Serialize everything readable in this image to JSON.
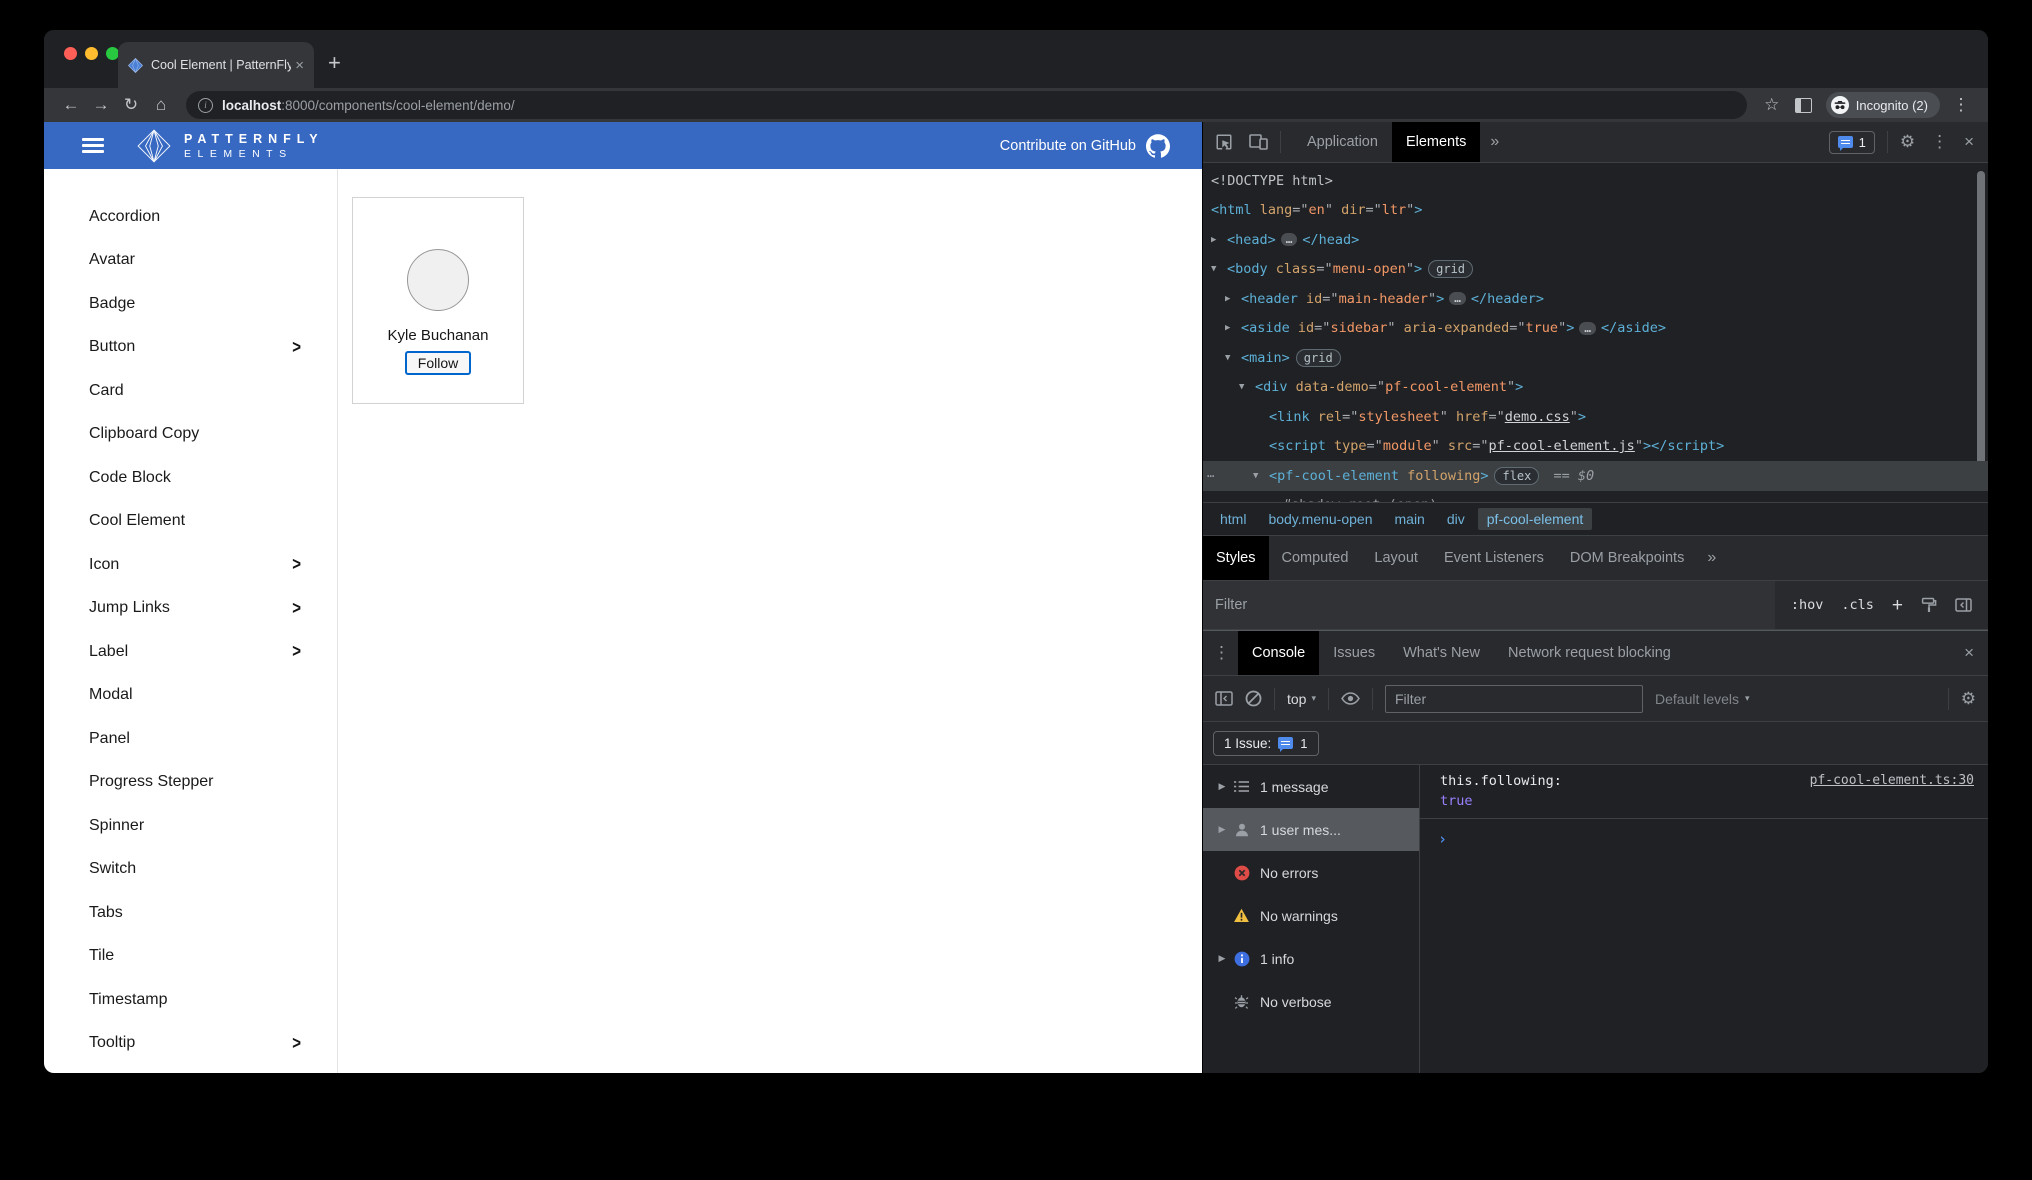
{
  "colors": {
    "brand_blue": "#3768c2",
    "follow_blue": "#0066cc",
    "tag_blue": "#5db0d7",
    "attr_orange": "#f29766",
    "bool_purple": "#9980ff",
    "issues_blue": "#4e8bec",
    "error_red": "#df4b47",
    "warning_yellow": "#f2c040",
    "info_blue": "#3d6fe0",
    "light_close": "#ff5f57",
    "light_min": "#febc2e",
    "light_max": "#28c840"
  },
  "icons": {
    "close": "×",
    "new_tab": "+",
    "back": "←",
    "forward": "→",
    "reload": "↻",
    "home": "⌂",
    "star": "☆",
    "kebab": "⋮",
    "gear": "⚙",
    "more": "»",
    "caret_down": "▾",
    "tri_down": "▼",
    "tri_right": "▶",
    "info": "i",
    "prompt": "›",
    "plus": "+"
  },
  "browser": {
    "tab_title": "Cool Element | PatternFly Elements",
    "url_host": "localhost",
    "url_path": ":8000/components/cool-element/demo/",
    "incognito_label": "Incognito (2)"
  },
  "site": {
    "brand_line1": "PATTERNFLY",
    "brand_line2": "ELEMENTS",
    "contribute_label": "Contribute on GitHub",
    "nav": [
      {
        "label": "Accordion",
        "expand": false
      },
      {
        "label": "Avatar",
        "expand": false
      },
      {
        "label": "Badge",
        "expand": false
      },
      {
        "label": "Button",
        "expand": true
      },
      {
        "label": "Card",
        "expand": false
      },
      {
        "label": "Clipboard Copy",
        "expand": false
      },
      {
        "label": "Code Block",
        "expand": false
      },
      {
        "label": "Cool Element",
        "expand": false
      },
      {
        "label": "Icon",
        "expand": true
      },
      {
        "label": "Jump Links",
        "expand": true
      },
      {
        "label": "Label",
        "expand": true
      },
      {
        "label": "Modal",
        "expand": false
      },
      {
        "label": "Panel",
        "expand": false
      },
      {
        "label": "Progress Stepper",
        "expand": false
      },
      {
        "label": "Spinner",
        "expand": false
      },
      {
        "label": "Switch",
        "expand": false
      },
      {
        "label": "Tabs",
        "expand": false
      },
      {
        "label": "Tile",
        "expand": false
      },
      {
        "label": "Timestamp",
        "expand": false
      },
      {
        "label": "Tooltip",
        "expand": true
      }
    ],
    "demo": {
      "person_name": "Kyle Buchanan",
      "follow_label": "Follow"
    }
  },
  "devtools": {
    "top": {
      "tab_application": "Application",
      "tab_elements": "Elements",
      "issues_count": "1"
    },
    "tree": {
      "lines": [
        {
          "indent": 0,
          "gutter": false,
          "tokens": [
            [
              "doc",
              "<!DOCTYPE html>"
            ]
          ]
        },
        {
          "indent": 0,
          "gutter": false,
          "tokens": [
            [
              "tag",
              "<html"
            ],
            [
              "an",
              " lang"
            ],
            [
              "q",
              "=\""
            ],
            [
              "av",
              "en"
            ],
            [
              "q",
              "\""
            ],
            [
              "an",
              " dir"
            ],
            [
              "q",
              "=\""
            ],
            [
              "av",
              "ltr"
            ],
            [
              "q",
              "\""
            ],
            [
              "tag",
              ">"
            ]
          ]
        },
        {
          "indent": 0,
          "arrow": "r",
          "tokens": [
            [
              "tag",
              "<head"
            ],
            [
              "tag",
              ">"
            ],
            [
              "ell",
              "…"
            ],
            [
              "tag",
              "</head>"
            ]
          ]
        },
        {
          "indent": 0,
          "arrow": "v",
          "tokens": [
            [
              "tag",
              "<body"
            ],
            [
              "an",
              " class"
            ],
            [
              "q",
              "=\""
            ],
            [
              "av",
              "menu-open"
            ],
            [
              "q",
              "\""
            ],
            [
              "tag",
              ">"
            ],
            [
              "badge",
              "grid"
            ]
          ]
        },
        {
          "indent": 1,
          "arrow": "r",
          "tokens": [
            [
              "tag",
              "<header"
            ],
            [
              "an",
              " id"
            ],
            [
              "q",
              "=\""
            ],
            [
              "av",
              "main-header"
            ],
            [
              "q",
              "\""
            ],
            [
              "tag",
              ">"
            ],
            [
              "ell",
              "…"
            ],
            [
              "tag",
              "</header>"
            ]
          ]
        },
        {
          "indent": 1,
          "arrow": "r",
          "tokens": [
            [
              "tag",
              "<aside"
            ],
            [
              "an",
              " id"
            ],
            [
              "q",
              "=\""
            ],
            [
              "av",
              "sidebar"
            ],
            [
              "q",
              "\""
            ],
            [
              "an",
              " aria-expanded"
            ],
            [
              "q",
              "=\""
            ],
            [
              "av",
              "true"
            ],
            [
              "q",
              "\""
            ],
            [
              "tag",
              ">"
            ],
            [
              "ell",
              "…"
            ],
            [
              "tag",
              "</aside>"
            ]
          ]
        },
        {
          "indent": 1,
          "arrow": "v",
          "tokens": [
            [
              "tag",
              "<main"
            ],
            [
              "tag",
              ">"
            ],
            [
              "badge",
              "grid"
            ]
          ]
        },
        {
          "indent": 2,
          "arrow": "v",
          "tokens": [
            [
              "tag",
              "<div"
            ],
            [
              "an",
              " data-demo"
            ],
            [
              "q",
              "=\""
            ],
            [
              "av",
              "pf-cool-element"
            ],
            [
              "q",
              "\""
            ],
            [
              "tag",
              ">"
            ]
          ]
        },
        {
          "indent": 3,
          "tokens": [
            [
              "tag",
              "<link"
            ],
            [
              "an",
              " rel"
            ],
            [
              "q",
              "=\""
            ],
            [
              "av",
              "stylesheet"
            ],
            [
              "q",
              "\""
            ],
            [
              "an",
              " href"
            ],
            [
              "q",
              "=\""
            ],
            [
              "lk",
              "demo.css"
            ],
            [
              "q",
              "\""
            ],
            [
              "tag",
              ">"
            ]
          ]
        },
        {
          "indent": 3,
          "tokens": [
            [
              "tag",
              "<script"
            ],
            [
              "an",
              " type"
            ],
            [
              "q",
              "=\""
            ],
            [
              "av",
              "module"
            ],
            [
              "q",
              "\""
            ],
            [
              "an",
              " src"
            ],
            [
              "q",
              "=\""
            ],
            [
              "lk",
              "pf-cool-element.js"
            ],
            [
              "q",
              "\""
            ],
            [
              "tag",
              ">"
            ],
            [
              "tag",
              "</script>"
            ]
          ]
        },
        {
          "indent": 3,
          "arrow": "v",
          "selected": true,
          "dots": true,
          "tokens": [
            [
              "tag",
              "<pf-cool-element"
            ],
            [
              "an",
              " following"
            ],
            [
              "tag",
              ">"
            ],
            [
              "badge",
              "flex"
            ],
            [
              "eq",
              " == "
            ],
            [
              "dol",
              "$0"
            ]
          ]
        },
        {
          "indent": 4,
          "arrow": "r",
          "tokens": [
            [
              "sh",
              "#shadow-root (open)"
            ]
          ]
        }
      ]
    },
    "breadcrumbs": [
      "html",
      "body.menu-open",
      "main",
      "div",
      "pf-cool-element"
    ],
    "styles_tabs": [
      "Styles",
      "Computed",
      "Layout",
      "Event Listeners",
      "DOM Breakpoints",
      "»"
    ],
    "styles_filter": {
      "placeholder": "Filter",
      "hov": ":hov",
      "cls": ".cls"
    },
    "console": {
      "tabs": [
        "Console",
        "Issues",
        "What's New",
        "Network request blocking"
      ],
      "toolbar": {
        "context": "top",
        "filter_placeholder": "Filter",
        "levels": "Default levels"
      },
      "issue_bar": {
        "label": "1 Issue:",
        "count": "1"
      },
      "sidebar": [
        {
          "icon": "list",
          "arrow": true,
          "label": "1 message"
        },
        {
          "icon": "person",
          "arrow": true,
          "label": "1 user mes...",
          "selected": true
        },
        {
          "icon": "error",
          "label": "No errors"
        },
        {
          "icon": "warning",
          "label": "No warnings"
        },
        {
          "icon": "info",
          "arrow": true,
          "label": "1 info"
        },
        {
          "icon": "verbose",
          "label": "No verbose"
        }
      ],
      "message": {
        "text": "this.following:",
        "value": "true",
        "source": "pf-cool-element.ts:30"
      }
    }
  }
}
